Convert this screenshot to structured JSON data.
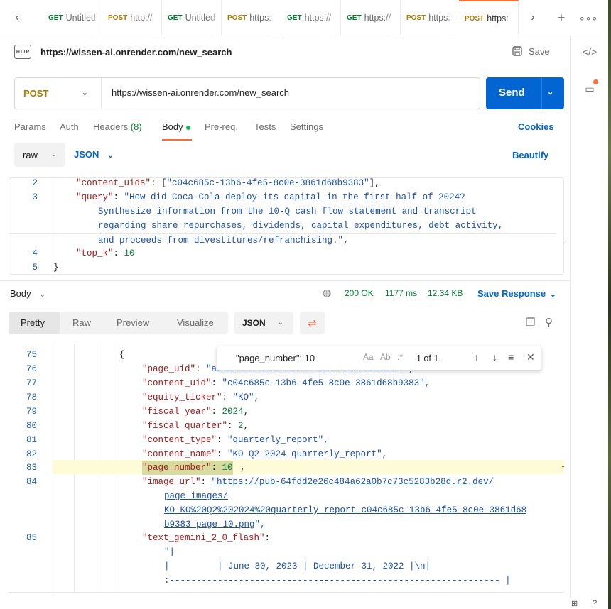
{
  "tabs": [
    {
      "method": "GET",
      "label": "Untitled"
    },
    {
      "method": "POST",
      "label": "http://"
    },
    {
      "method": "GET",
      "label": "Untitled"
    },
    {
      "method": "POST",
      "label": "https:"
    },
    {
      "method": "GET",
      "label": "https://"
    },
    {
      "method": "GET",
      "label": "https://"
    },
    {
      "method": "POST",
      "label": "https:"
    },
    {
      "method": "POST",
      "label": "https:"
    }
  ],
  "header": {
    "icon_text": "HTTP",
    "title": "https://wissen-ai.onrender.com/new_search",
    "save_label": "Save"
  },
  "request": {
    "method": "POST",
    "url": "https://wissen-ai.onrender.com/new_search",
    "send_label": "Send"
  },
  "request_tabs": {
    "params": "Params",
    "auth": "Auth",
    "headers": "Headers",
    "headers_count": "(8)",
    "body": "Body",
    "prereq": "Pre-req.",
    "tests": "Tests",
    "settings": "Settings",
    "cookies": "Cookies"
  },
  "body_options": {
    "mode": "raw",
    "language": "JSON",
    "beautify": "Beautify"
  },
  "request_body": {
    "lines": [
      {
        "n": "2",
        "key": "\"content_uids\"",
        "rest": ": [",
        "str": "\"c04c685c-13b6-4fe5-8c0e-3861d68b9383\"",
        "tail": "],"
      },
      {
        "n": "3",
        "key": "\"query\"",
        "rest": ": ",
        "str": "\"How did Coca-Cola deploy its capital in the first half of 2024?",
        "tail": ""
      },
      {
        "n": "",
        "key": "",
        "rest": "    ",
        "str": "Synthesize information from the 10-Q cash flow statement and transcript",
        "tail": ""
      },
      {
        "n": "",
        "key": "",
        "rest": "    ",
        "str": "regarding share repurchases, dividends, capital expenditures, debt activity,",
        "tail": ""
      },
      {
        "n": "",
        "key": "",
        "rest": "    ",
        "str": "and proceeds from divestitures/refranchising.\"",
        "tail": ","
      },
      {
        "n": "4",
        "key": "\"top_k\"",
        "rest": ": ",
        "num": "10",
        "tail": ""
      },
      {
        "n": "5",
        "brace": "}"
      }
    ]
  },
  "response_bar": {
    "label": "Body",
    "status": "200 OK",
    "time": "1177 ms",
    "size": "12.34 KB",
    "save": "Save Response"
  },
  "view_tabs": {
    "pretty": "Pretty",
    "raw": "Raw",
    "preview": "Preview",
    "visualize": "Visualize",
    "format": "JSON"
  },
  "find": {
    "query": "\"page_number\": 10",
    "case_icon": "Aa",
    "word_icon": "Ab",
    "regex_icon": ".*",
    "count": "1 of 1"
  },
  "response_lines": {
    "l75": {
      "n": "75",
      "text": "{"
    },
    "l76": {
      "n": "76",
      "key": "\"page_uid\"",
      "str": "\"ac0175ce-ad5a-4846-9bba-524e50bd16a4\","
    },
    "l77": {
      "n": "77",
      "key": "\"content_uid\"",
      "str": "\"c04c685c-13b6-4fe5-8c0e-3861d68b9383\","
    },
    "l78": {
      "n": "78",
      "key": "\"equity_ticker\"",
      "str": "\"KO\","
    },
    "l79": {
      "n": "79",
      "key": "\"fiscal_year\"",
      "num": "2024",
      "tail": ","
    },
    "l80": {
      "n": "80",
      "key": "\"fiscal_quarter\"",
      "num": "2",
      "tail": ","
    },
    "l81": {
      "n": "81",
      "key": "\"content_type\"",
      "str": "\"quarterly_report\","
    },
    "l82": {
      "n": "82",
      "key": "\"content_name\"",
      "str": "\"KO Q2 2024 quarterly_report\","
    },
    "l83": {
      "n": "83",
      "key": "\"page_number\"",
      "num": "10",
      "tail": ","
    },
    "l84": {
      "n": "84",
      "key": "\"image_url\"",
      "url1": "\"https://pub-64fdd2e26c484a62a0b7c73c5283b28d.r2.dev/",
      "url2": "page_images/",
      "url3": "KO_KO%20Q2%202024%20quarterly_report_c04c685c-13b6-4fe5-8c0e-3861d68",
      "url4": "b9383_page_10.png",
      "tail": "\","
    },
    "l85": {
      "n": "85",
      "key": "\"text_gemini_2_0_flash\"",
      "s1": "\"|",
      "s2": "|         | June 30, 2023 | December 31, 2022 |\\n|",
      "s3": ":-------------------------------------------------------------- |"
    }
  }
}
